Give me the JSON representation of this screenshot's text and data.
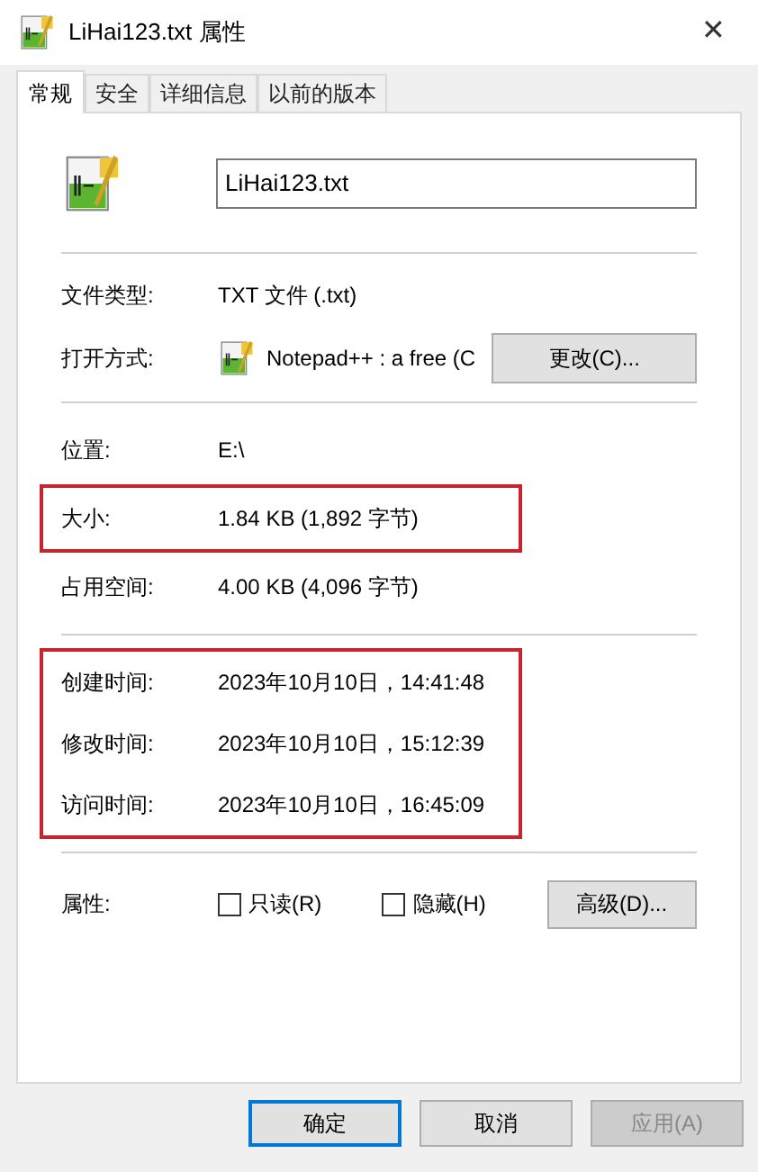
{
  "window": {
    "title": "LiHai123.txt 属性",
    "close": "✕"
  },
  "tabs": [
    {
      "label": "常规",
      "selected": true
    },
    {
      "label": "安全",
      "selected": false
    },
    {
      "label": "详细信息",
      "selected": false
    },
    {
      "label": "以前的版本",
      "selected": false
    }
  ],
  "file_name": {
    "value": "LiHai123.txt"
  },
  "file_type": {
    "label": "文件类型:",
    "value": "TXT 文件 (.txt)"
  },
  "opens_with": {
    "label": "打开方式:",
    "value": "Notepad++ : a free (C",
    "button": "更改(C)..."
  },
  "location_section": [
    {
      "highlighted": false,
      "rows": [
        {
          "label": "位置:",
          "value": "E:\\"
        }
      ]
    },
    {
      "highlighted": true,
      "rows": [
        {
          "label": "大小:",
          "value": "1.84 KB (1,892 字节)"
        }
      ]
    },
    {
      "highlighted": false,
      "rows": [
        {
          "label": "占用空间:",
          "value": "4.00 KB (4,096 字节)"
        }
      ]
    }
  ],
  "time_section": [
    {
      "highlighted": true,
      "rows": [
        {
          "label": "创建时间:",
          "value": "2023年10月10日，14:41:48"
        },
        {
          "label": "修改时间:",
          "value": "2023年10月10日，15:12:39"
        },
        {
          "label": "访问时间:",
          "value": "2023年10月10日，16:45:09"
        }
      ]
    }
  ],
  "attributes": {
    "label": "属性:",
    "checkboxes": [
      {
        "label": "只读(R)",
        "checked": false
      },
      {
        "label": "隐藏(H)",
        "checked": false
      }
    ],
    "button": "高级(D)..."
  },
  "buttons": [
    {
      "label": "确定",
      "selected": true,
      "disabled": false
    },
    {
      "label": "取消",
      "selected": false,
      "disabled": false
    },
    {
      "label": "应用(A)",
      "selected": false,
      "disabled": true
    }
  ]
}
